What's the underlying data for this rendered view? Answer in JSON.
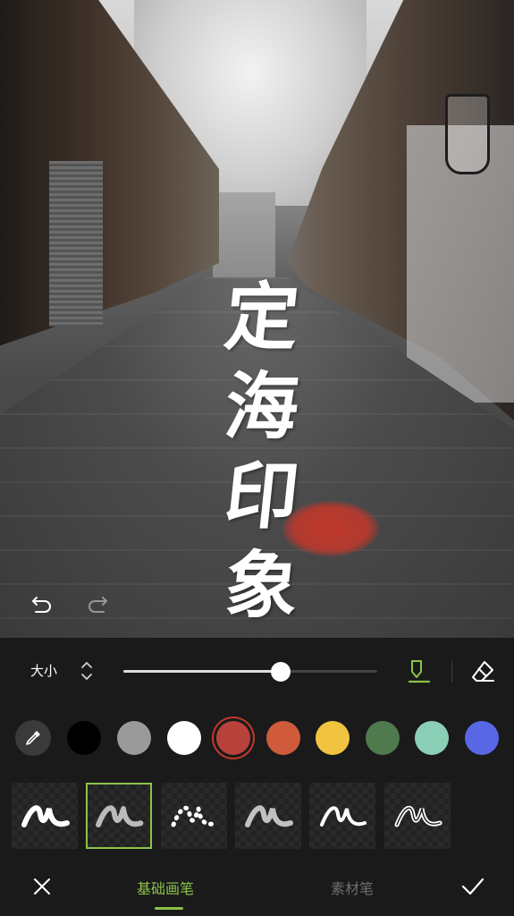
{
  "canvas": {
    "calligraphy_chars": [
      "定",
      "海",
      "印",
      "象"
    ]
  },
  "toolbar": {
    "size_label": "大小",
    "size_value_percent": 62
  },
  "colors": {
    "selected_index": 3,
    "swatches": [
      "#000000",
      "#9a9a9a",
      "#ffffff",
      "#b7423b",
      "#cf5a3c",
      "#f0c440",
      "#4f7a4e",
      "#8ccfb7",
      "#5867e4"
    ]
  },
  "brushes": {
    "selected_index": 1,
    "count": 6
  },
  "tabs": {
    "basic_label": "基础画笔",
    "material_label": "素材笔",
    "active": "basic"
  },
  "accent_color": "#8bc34a"
}
